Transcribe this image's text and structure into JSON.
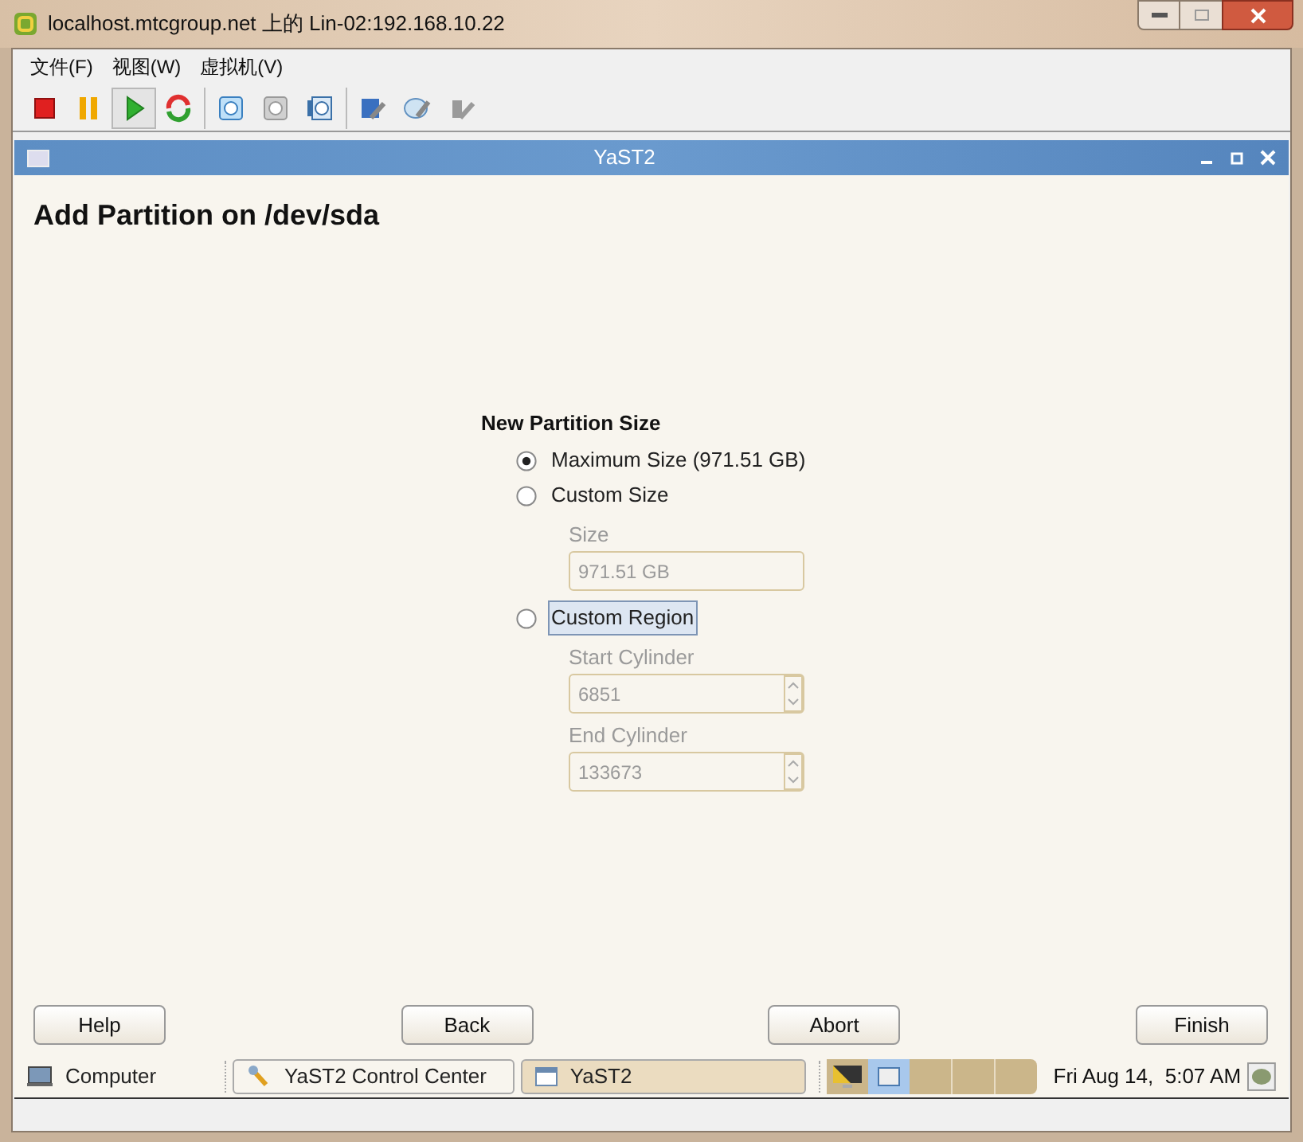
{
  "window": {
    "title": "localhost.mtcgroup.net 上的 Lin-02:192.168.10.22"
  },
  "menu": [
    "文件(F)",
    "视图(W)",
    "虚拟机(V)"
  ],
  "toolbar": [
    {
      "kind": "stop",
      "selected": false,
      "disabled": false
    },
    {
      "kind": "pause",
      "selected": false,
      "disabled": false
    },
    {
      "kind": "play",
      "selected": true,
      "disabled": false
    },
    {
      "kind": "reset",
      "selected": false,
      "disabled": false
    },
    {
      "kind": "snapshot",
      "selected": false,
      "disabled": false
    },
    {
      "kind": "snapshot",
      "selected": false,
      "disabled": true
    },
    {
      "kind": "manager",
      "selected": false,
      "disabled": false
    },
    {
      "kind": "disk",
      "selected": false,
      "disabled": false
    },
    {
      "kind": "cd",
      "selected": false,
      "disabled": false
    },
    {
      "kind": "usb",
      "selected": false,
      "disabled": true
    }
  ],
  "dialog": {
    "title": "YaST2",
    "heading": "Add Partition on /dev/sda",
    "group_label": "New Partition Size",
    "options": [
      {
        "label": "Maximum Size (971.51 GB)",
        "selected": true,
        "focused": false
      },
      {
        "label": "Custom Size",
        "selected": false,
        "focused": false,
        "fields": [
          {
            "kind": "text",
            "label": "Size",
            "value": "971.51 GB",
            "disabled": true
          }
        ]
      },
      {
        "label": "Custom Region",
        "selected": false,
        "focused": true,
        "fields": [
          {
            "kind": "spin",
            "label": "Start Cylinder",
            "value": "6851",
            "disabled": true
          },
          {
            "kind": "spin",
            "label": "End Cylinder",
            "value": "133673",
            "disabled": true
          }
        ]
      }
    ],
    "buttons": [
      "Help",
      "Back",
      "Abort",
      "Finish"
    ]
  },
  "taskbar": {
    "launcher": "Computer",
    "tasks": [
      {
        "kind": "tool",
        "label": "YaST2 Control Center",
        "selected": false
      },
      {
        "kind": "window",
        "label": "YaST2",
        "selected": true
      }
    ],
    "clock": "Fri Aug 14,  5:07 AM"
  }
}
